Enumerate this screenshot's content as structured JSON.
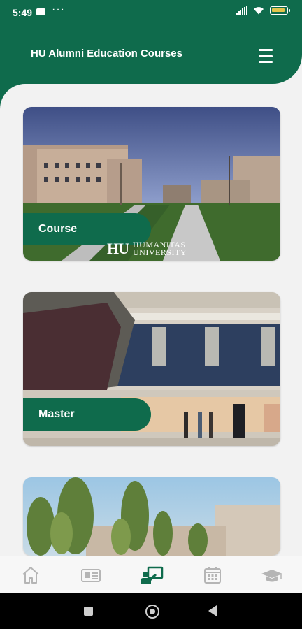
{
  "status_bar": {
    "time": "5:49",
    "notification_icon": "youtube-icon",
    "more": "···",
    "battery_color": "#e2c44b"
  },
  "header": {
    "title": "HU Alumni Education Courses",
    "menu_icon": "hamburger-menu-icon"
  },
  "cards": [
    {
      "label": "Course",
      "image": "campus-exterior-photo",
      "logo_initials": "HU",
      "logo_text_line1": "HUMANITAS",
      "logo_text_line2": "UNIVERSITY"
    },
    {
      "label": "Master",
      "image": "campus-atrium-photo"
    },
    {
      "label": "",
      "image": "campus-trees-photo"
    }
  ],
  "bottom_nav": {
    "items": [
      {
        "icon": "home-icon",
        "active": false
      },
      {
        "icon": "news-icon",
        "active": false
      },
      {
        "icon": "courses-icon",
        "active": true
      },
      {
        "icon": "calendar-icon",
        "active": false
      },
      {
        "icon": "graduation-cap-icon",
        "active": false
      }
    ],
    "active_color": "#0f6b4c",
    "inactive_color": "#b5b5b5"
  },
  "colors": {
    "brand": "#0f6b4c",
    "background": "#f2f2f2"
  }
}
